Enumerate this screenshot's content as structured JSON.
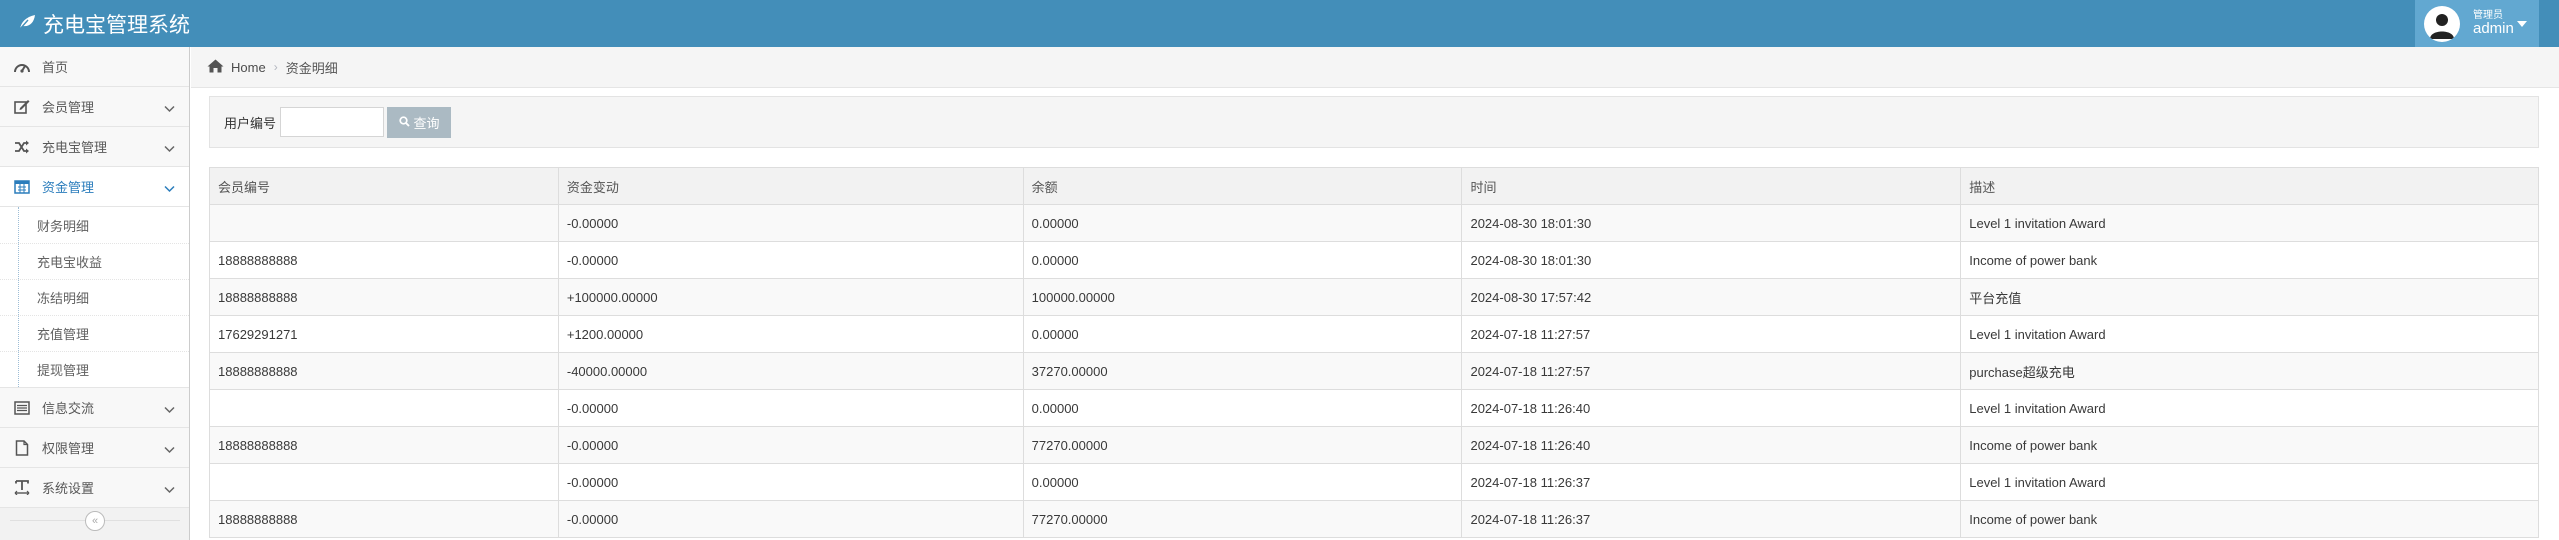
{
  "app": {
    "title": "充电宝管理系统",
    "user_role": "管理员",
    "user_name": "admin"
  },
  "sidebar": {
    "items": [
      {
        "label": "首页",
        "icon": "dashboard-icon"
      },
      {
        "label": "会员管理",
        "icon": "edit-icon"
      },
      {
        "label": "充电宝管理",
        "icon": "random-icon"
      },
      {
        "label": "资金管理",
        "icon": "calendar-icon"
      },
      {
        "label": "信息交流",
        "icon": "list-alt-icon"
      },
      {
        "label": "权限管理",
        "icon": "file-icon"
      },
      {
        "label": "系统设置",
        "icon": "text-width-icon"
      }
    ],
    "submenu": [
      "财务明细",
      "充电宝收益",
      "冻结明细",
      "充值管理",
      "提现管理"
    ],
    "collapse_glyph": "«"
  },
  "breadcrumb": {
    "home": "Home",
    "current": "资金明细"
  },
  "search": {
    "label": "用户编号",
    "value": "",
    "button": "查询"
  },
  "table": {
    "headers": [
      "会员编号",
      "资金变动",
      "余额",
      "时间",
      "描述"
    ],
    "rows": [
      [
        "",
        "-0.00000",
        "0.00000",
        "2024-08-30 18:01:30",
        "Level 1 invitation Award"
      ],
      [
        "18888888888",
        "-0.00000",
        "0.00000",
        "2024-08-30 18:01:30",
        "Income of power bank"
      ],
      [
        "18888888888",
        "+100000.00000",
        "100000.00000",
        "2024-08-30 17:57:42",
        "平台充值"
      ],
      [
        "17629291271",
        "+1200.00000",
        "0.00000",
        "2024-07-18 11:27:57",
        "Level 1 invitation Award"
      ],
      [
        "18888888888",
        "-40000.00000",
        "37270.00000",
        "2024-07-18 11:27:57",
        "purchase超级充电"
      ],
      [
        "",
        "-0.00000",
        "0.00000",
        "2024-07-18 11:26:40",
        "Level 1 invitation Award"
      ],
      [
        "18888888888",
        "-0.00000",
        "77270.00000",
        "2024-07-18 11:26:40",
        "Income of power bank"
      ],
      [
        "",
        "-0.00000",
        "0.00000",
        "2024-07-18 11:26:37",
        "Level 1 invitation Award"
      ],
      [
        "18888888888",
        "-0.00000",
        "77270.00000",
        "2024-07-18 11:26:37",
        "Income of power bank"
      ]
    ]
  },
  "colors": {
    "navbar": "#438eb9",
    "user_box": "#62a8d1",
    "active_menu": "#2b7dbc",
    "search_button": "#abbac3"
  }
}
